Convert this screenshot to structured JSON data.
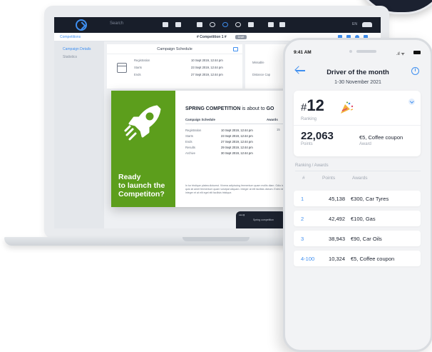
{
  "laptop": {
    "appbar": {
      "search_label": "Search",
      "lang_label": "EN"
    },
    "subbar": {
      "back_label": "Competitions",
      "title": "# Competition 1 #",
      "status_pill": "Draft"
    },
    "sidebar": {
      "items": [
        {
          "label": "Campaign Details"
        },
        {
          "label": "Statistics"
        }
      ]
    },
    "schedule_card": {
      "title": "Campaign Schedule",
      "rows": [
        {
          "label": "Registration",
          "value": "10 Sept 2019, 12:44 pm"
        },
        {
          "label": "Starts",
          "value": "23 Sept 2019, 12:44 pm"
        },
        {
          "label": "Ends",
          "value": "27 Sept 2019, 12:44 pm"
        }
      ]
    },
    "second_card": {
      "labels": [
        "Missable",
        "Distance Cap"
      ]
    },
    "popup": {
      "cta_lines": [
        "Ready",
        "to launch the",
        "Competiton?"
      ],
      "title_part1": "SPRING COMPETITION",
      "title_part2": " is about to ",
      "title_part3": "GO",
      "col_left": "Campaign Schedule",
      "col_right": "Awards",
      "rows": [
        {
          "label": "Registration",
          "value": "10 Sept 2019, 12:44 pm"
        },
        {
          "label": "Starts",
          "value": "23 Sept 2019, 12:44 pm"
        },
        {
          "label": "Ends",
          "value": "27 Sept 2019, 12:44 pm"
        },
        {
          "label": "Results",
          "value": "29 Sept 2019, 12:44 pm"
        },
        {
          "label": "Archive",
          "value": "30 Sept 2019, 12:44 pm"
        }
      ],
      "trailing_cell": "15",
      "paragraph": "In tur tristique platea dictumst. Viverra adipiscing fermentum quam mollis diam. Odio lacus quis sit amet fermentum quam volutpat aliquam. Integer at elit facilisis dictum. Enim nisi elit integer et at elit eget elit facilisis tristique."
    },
    "mini_phone_label": "Spring competition"
  },
  "phone": {
    "time": "9:41 AM",
    "title": "Driver of the month",
    "subtitle": "1-30 November 2021",
    "rank_hash": "#",
    "rank_value": "12",
    "rank_label": "Ranking",
    "points_value": "22,063",
    "points_label": "Points",
    "award_value": "€5, Coffee coupon",
    "award_label": "Award",
    "section_title": "Ranking / Awards",
    "columns": {
      "rank": "#",
      "points": "Points",
      "awards": "Awards"
    },
    "rows": [
      {
        "rank": "1",
        "points": "45,138",
        "award": "€300, Car Tyres"
      },
      {
        "rank": "2",
        "points": "42,492",
        "award": "€100, Gas"
      },
      {
        "rank": "3",
        "points": "38,943",
        "award": "€90, Car Oils"
      },
      {
        "rank": "4-100",
        "points": "10,324",
        "award": "€5, Coffee coupon"
      }
    ],
    "accent_color": "#3f8ff0"
  },
  "icons": {
    "logo": "logo-icon",
    "back": "arrow-left-icon",
    "info": "info-icon",
    "party": "party-popper-icon",
    "expand": "chevron-down-icon",
    "rocket": "rocket-icon",
    "calendar": "calendar-icon"
  },
  "colors": {
    "brand_green": "#5c9e1c",
    "appbar_dark": "#181e2a",
    "accent_blue": "#3f8ff0"
  }
}
